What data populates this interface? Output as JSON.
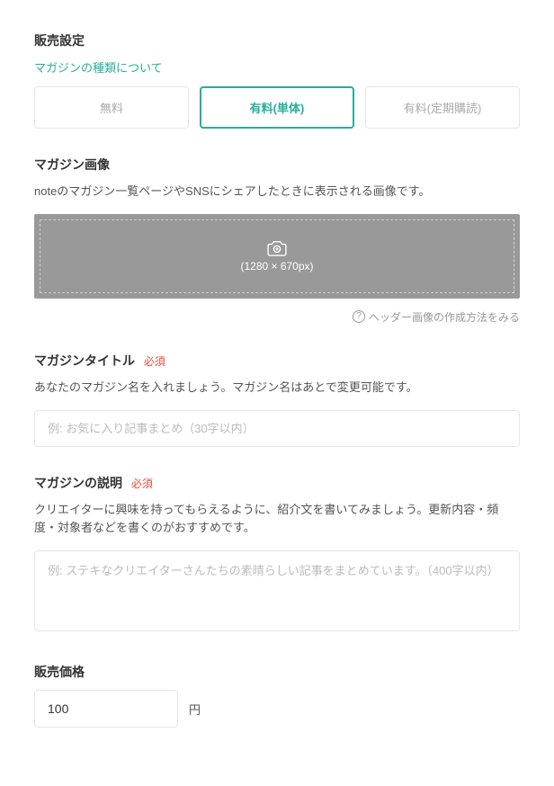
{
  "sales_settings": {
    "title": "販売設定",
    "about_link": "マガジンの種類について",
    "tabs": {
      "free": "無料",
      "paid_single": "有料(単体)",
      "paid_sub": "有料(定期購読)"
    }
  },
  "magazine_image": {
    "title": "マガジン画像",
    "help": "noteのマガジン一覧ページやSNSにシェアしたときに表示される画像です。",
    "size_label": "(1280 × 670px)",
    "how_to": "ヘッダー画像の作成方法をみる"
  },
  "magazine_title": {
    "title": "マガジンタイトル",
    "required": "必須",
    "help": "あなたのマガジン名を入れましょう。マガジン名はあとで変更可能です。",
    "placeholder": "例: お気に入り記事まとめ（30字以内）"
  },
  "magazine_desc": {
    "title": "マガジンの説明",
    "required": "必須",
    "help": "クリエイターに興味を持ってもらえるように、紹介文を書いてみましょう。更新内容・頻度・対象者などを書くのがおすすめです。",
    "placeholder": "例: ステキなクリエイターさんたちの素晴らしい記事をまとめています。（400字以内）"
  },
  "price": {
    "title": "販売価格",
    "value": "100",
    "currency": "円"
  }
}
